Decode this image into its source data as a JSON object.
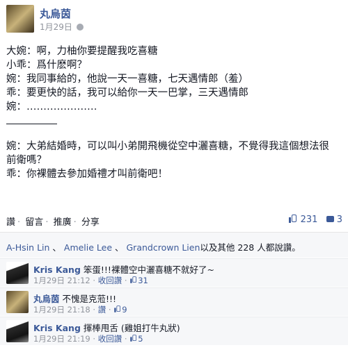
{
  "post": {
    "author": "丸烏茵",
    "date": "1月29日",
    "body": [
      "大婉：啊，力柚你要提醒我吃喜糖",
      "小乖：爲什麽啊？",
      "婉：我同事給的，他說一天一喜糖，七天遇情郎（羞）",
      "乖：要更快的話，我可以給你一天一巴掌，三天遇情郎",
      "婉：…………………"
    ],
    "body2": [
      "婉：大弟結婚時，可以叫小弟開飛機從空中灑喜糖，不覺得我這個想法很",
      "前衛嗎？",
      "乖：你裸體去參加婚禮才叫前衛吧！"
    ]
  },
  "actions": {
    "like": "讚",
    "comment": "留言",
    "share_rec": "推廣",
    "share": "分享",
    "like_count": "231",
    "comment_count": "3"
  },
  "likes": {
    "name1": "A-Hsin Lin",
    "name2": "Amelie Lee",
    "name3": "Grandcrown Lien",
    "suffix": "以及其他 228 人都說讚。"
  },
  "comments": [
    {
      "name": "Kris Kang",
      "text": "笨蛋!!!裸體空中灑喜糖不就好了~",
      "date": "1月29日 21:12",
      "action": "收回讚",
      "likes": "31"
    },
    {
      "name": "丸烏茵",
      "text": "不愧是克蒞!!!",
      "date": "1月29日 21:18",
      "action": "讚",
      "likes": "9"
    },
    {
      "name": "Kris Kang",
      "text": "揮棒甩舌 (雞姐打牛丸狀)",
      "date": "1月29日 21:19",
      "action": "收回讚",
      "likes": "5"
    }
  ]
}
